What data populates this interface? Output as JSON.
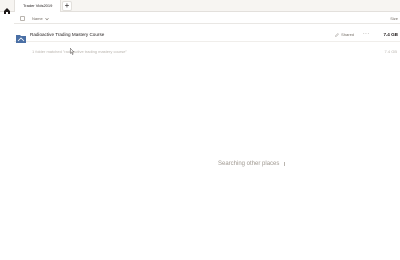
{
  "tabbar": {
    "home_icon": "home-icon",
    "active_tab": "Trader Vids2019",
    "new_tab_label": "+"
  },
  "header": {
    "name_label": "Name",
    "sort_icon": "chevron-down-icon",
    "size_label": "Size"
  },
  "file_row": {
    "icon": "folder-icon",
    "name": "Radioactive Trading Mastery Course",
    "share_label": "Shared",
    "more_label": "···",
    "size": "7.4 GB"
  },
  "matches": {
    "text": "1 folder matched \"radioactive trading mastery course\"",
    "size": "7.4 GB"
  },
  "status": {
    "searching_text": "Searching other places"
  },
  "colors": {
    "folder": "#4a6fa5",
    "text_primary": "#1e1919",
    "text_muted": "#b9b4ae"
  }
}
